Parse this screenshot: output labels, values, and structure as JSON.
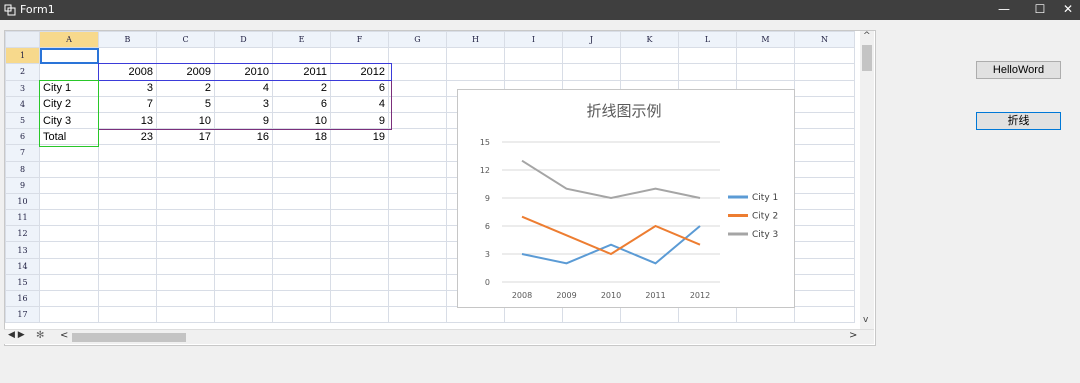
{
  "window": {
    "title": "Form1",
    "min": "—",
    "max": "☐",
    "close": "✕"
  },
  "sheet": {
    "columns": [
      "A",
      "B",
      "C",
      "D",
      "E",
      "F",
      "G",
      "H",
      "I",
      "J",
      "K",
      "L",
      "M",
      "N"
    ],
    "rows": [
      [
        "",
        "",
        "",
        "",
        "",
        "",
        "",
        "",
        "",
        "",
        "",
        "",
        "",
        ""
      ],
      [
        "",
        "2008",
        "2009",
        "2010",
        "2011",
        "2012",
        "",
        "",
        "",
        "",
        "",
        "",
        "",
        ""
      ],
      [
        "City 1",
        "3",
        "2",
        "4",
        "2",
        "6",
        "",
        "",
        "",
        "",
        "",
        "",
        "",
        ""
      ],
      [
        "City 2",
        "7",
        "5",
        "3",
        "6",
        "4",
        "",
        "",
        "",
        "",
        "",
        "",
        "",
        ""
      ],
      [
        "City 3",
        "13",
        "10",
        "9",
        "10",
        "9",
        "",
        "",
        "",
        "",
        "",
        "",
        "",
        ""
      ],
      [
        "Total",
        "23",
        "17",
        "16",
        "18",
        "19",
        "",
        "",
        "",
        "",
        "",
        "",
        "",
        ""
      ],
      [
        "",
        "",
        "",
        "",
        "",
        "",
        "",
        "",
        "",
        "",
        "",
        "",
        "",
        ""
      ],
      [
        "",
        "",
        "",
        "",
        "",
        "",
        "",
        "",
        "",
        "",
        "",
        "",
        "",
        ""
      ],
      [
        "",
        "",
        "",
        "",
        "",
        "",
        "",
        "",
        "",
        "",
        "",
        "",
        "",
        ""
      ],
      [
        "",
        "",
        "",
        "",
        "",
        "",
        "",
        "",
        "",
        "",
        "",
        "",
        "",
        ""
      ],
      [
        "",
        "",
        "",
        "",
        "",
        "",
        "",
        "",
        "",
        "",
        "",
        "",
        "",
        ""
      ],
      [
        "",
        "",
        "",
        "",
        "",
        "",
        "",
        "",
        "",
        "",
        "",
        "",
        "",
        ""
      ],
      [
        "",
        "",
        "",
        "",
        "",
        "",
        "",
        "",
        "",
        "",
        "",
        "",
        "",
        ""
      ],
      [
        "",
        "",
        "",
        "",
        "",
        "",
        "",
        "",
        "",
        "",
        "",
        "",
        "",
        ""
      ],
      [
        "",
        "",
        "",
        "",
        "",
        "",
        "",
        "",
        "",
        "",
        "",
        "",
        "",
        ""
      ],
      [
        "",
        "",
        "",
        "",
        "",
        "",
        "",
        "",
        "",
        "",
        "",
        "",
        "",
        ""
      ],
      [
        "",
        "",
        "",
        "",
        "",
        "",
        "",
        "",
        "",
        "",
        "",
        "",
        "",
        ""
      ]
    ],
    "row_numbers": [
      "1",
      "2",
      "3",
      "4",
      "5",
      "6",
      "7",
      "8",
      "9",
      "10",
      "11",
      "12",
      "13",
      "14",
      "15",
      "16",
      "17"
    ],
    "sheet_nav": "◀ ▶",
    "add_sheet": "✻",
    "scroll_left": "<",
    "scroll_right": ">",
    "scroll_up": "^",
    "scroll_down": "v"
  },
  "buttons": {
    "hello": "HelloWord",
    "line": "折线"
  },
  "chart_data": {
    "type": "line",
    "title": "折线图示例",
    "categories": [
      "2008",
      "2009",
      "2010",
      "2011",
      "2012"
    ],
    "series": [
      {
        "name": "City 1",
        "values": [
          3,
          2,
          4,
          2,
          6
        ],
        "color": "#5b9bd5"
      },
      {
        "name": "City 2",
        "values": [
          7,
          5,
          3,
          6,
          4
        ],
        "color": "#ed7d31"
      },
      {
        "name": "City 3",
        "values": [
          13,
          10,
          9,
          10,
          9
        ],
        "color": "#a5a5a5"
      }
    ],
    "ylim": [
      0,
      15
    ],
    "yticks": [
      "0",
      "3",
      "6",
      "9",
      "12",
      "15"
    ],
    "grid": true,
    "legend": "right"
  }
}
